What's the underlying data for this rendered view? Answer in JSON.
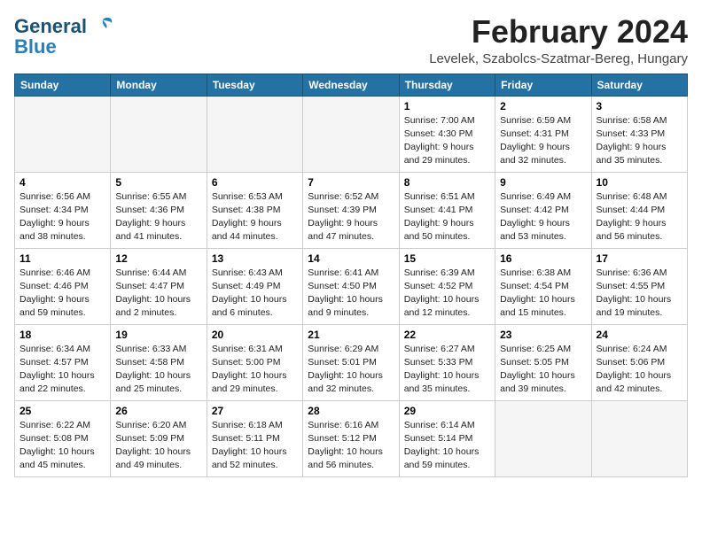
{
  "header": {
    "logo_general": "General",
    "logo_blue": "Blue",
    "month_title": "February 2024",
    "location": "Levelek, Szabolcs-Szatmar-Bereg, Hungary"
  },
  "weekdays": [
    "Sunday",
    "Monday",
    "Tuesday",
    "Wednesday",
    "Thursday",
    "Friday",
    "Saturday"
  ],
  "weeks": [
    [
      {
        "day": "",
        "info": ""
      },
      {
        "day": "",
        "info": ""
      },
      {
        "day": "",
        "info": ""
      },
      {
        "day": "",
        "info": ""
      },
      {
        "day": "1",
        "info": "Sunrise: 7:00 AM\nSunset: 4:30 PM\nDaylight: 9 hours\nand 29 minutes."
      },
      {
        "day": "2",
        "info": "Sunrise: 6:59 AM\nSunset: 4:31 PM\nDaylight: 9 hours\nand 32 minutes."
      },
      {
        "day": "3",
        "info": "Sunrise: 6:58 AM\nSunset: 4:33 PM\nDaylight: 9 hours\nand 35 minutes."
      }
    ],
    [
      {
        "day": "4",
        "info": "Sunrise: 6:56 AM\nSunset: 4:34 PM\nDaylight: 9 hours\nand 38 minutes."
      },
      {
        "day": "5",
        "info": "Sunrise: 6:55 AM\nSunset: 4:36 PM\nDaylight: 9 hours\nand 41 minutes."
      },
      {
        "day": "6",
        "info": "Sunrise: 6:53 AM\nSunset: 4:38 PM\nDaylight: 9 hours\nand 44 minutes."
      },
      {
        "day": "7",
        "info": "Sunrise: 6:52 AM\nSunset: 4:39 PM\nDaylight: 9 hours\nand 47 minutes."
      },
      {
        "day": "8",
        "info": "Sunrise: 6:51 AM\nSunset: 4:41 PM\nDaylight: 9 hours\nand 50 minutes."
      },
      {
        "day": "9",
        "info": "Sunrise: 6:49 AM\nSunset: 4:42 PM\nDaylight: 9 hours\nand 53 minutes."
      },
      {
        "day": "10",
        "info": "Sunrise: 6:48 AM\nSunset: 4:44 PM\nDaylight: 9 hours\nand 56 minutes."
      }
    ],
    [
      {
        "day": "11",
        "info": "Sunrise: 6:46 AM\nSunset: 4:46 PM\nDaylight: 9 hours\nand 59 minutes."
      },
      {
        "day": "12",
        "info": "Sunrise: 6:44 AM\nSunset: 4:47 PM\nDaylight: 10 hours\nand 2 minutes."
      },
      {
        "day": "13",
        "info": "Sunrise: 6:43 AM\nSunset: 4:49 PM\nDaylight: 10 hours\nand 6 minutes."
      },
      {
        "day": "14",
        "info": "Sunrise: 6:41 AM\nSunset: 4:50 PM\nDaylight: 10 hours\nand 9 minutes."
      },
      {
        "day": "15",
        "info": "Sunrise: 6:39 AM\nSunset: 4:52 PM\nDaylight: 10 hours\nand 12 minutes."
      },
      {
        "day": "16",
        "info": "Sunrise: 6:38 AM\nSunset: 4:54 PM\nDaylight: 10 hours\nand 15 minutes."
      },
      {
        "day": "17",
        "info": "Sunrise: 6:36 AM\nSunset: 4:55 PM\nDaylight: 10 hours\nand 19 minutes."
      }
    ],
    [
      {
        "day": "18",
        "info": "Sunrise: 6:34 AM\nSunset: 4:57 PM\nDaylight: 10 hours\nand 22 minutes."
      },
      {
        "day": "19",
        "info": "Sunrise: 6:33 AM\nSunset: 4:58 PM\nDaylight: 10 hours\nand 25 minutes."
      },
      {
        "day": "20",
        "info": "Sunrise: 6:31 AM\nSunset: 5:00 PM\nDaylight: 10 hours\nand 29 minutes."
      },
      {
        "day": "21",
        "info": "Sunrise: 6:29 AM\nSunset: 5:01 PM\nDaylight: 10 hours\nand 32 minutes."
      },
      {
        "day": "22",
        "info": "Sunrise: 6:27 AM\nSunset: 5:33 PM\nDaylight: 10 hours\nand 35 minutes."
      },
      {
        "day": "23",
        "info": "Sunrise: 6:25 AM\nSunset: 5:05 PM\nDaylight: 10 hours\nand 39 minutes."
      },
      {
        "day": "24",
        "info": "Sunrise: 6:24 AM\nSunset: 5:06 PM\nDaylight: 10 hours\nand 42 minutes."
      }
    ],
    [
      {
        "day": "25",
        "info": "Sunrise: 6:22 AM\nSunset: 5:08 PM\nDaylight: 10 hours\nand 45 minutes."
      },
      {
        "day": "26",
        "info": "Sunrise: 6:20 AM\nSunset: 5:09 PM\nDaylight: 10 hours\nand 49 minutes."
      },
      {
        "day": "27",
        "info": "Sunrise: 6:18 AM\nSunset: 5:11 PM\nDaylight: 10 hours\nand 52 minutes."
      },
      {
        "day": "28",
        "info": "Sunrise: 6:16 AM\nSunset: 5:12 PM\nDaylight: 10 hours\nand 56 minutes."
      },
      {
        "day": "29",
        "info": "Sunrise: 6:14 AM\nSunset: 5:14 PM\nDaylight: 10 hours\nand 59 minutes."
      },
      {
        "day": "",
        "info": ""
      },
      {
        "day": "",
        "info": ""
      }
    ]
  ]
}
